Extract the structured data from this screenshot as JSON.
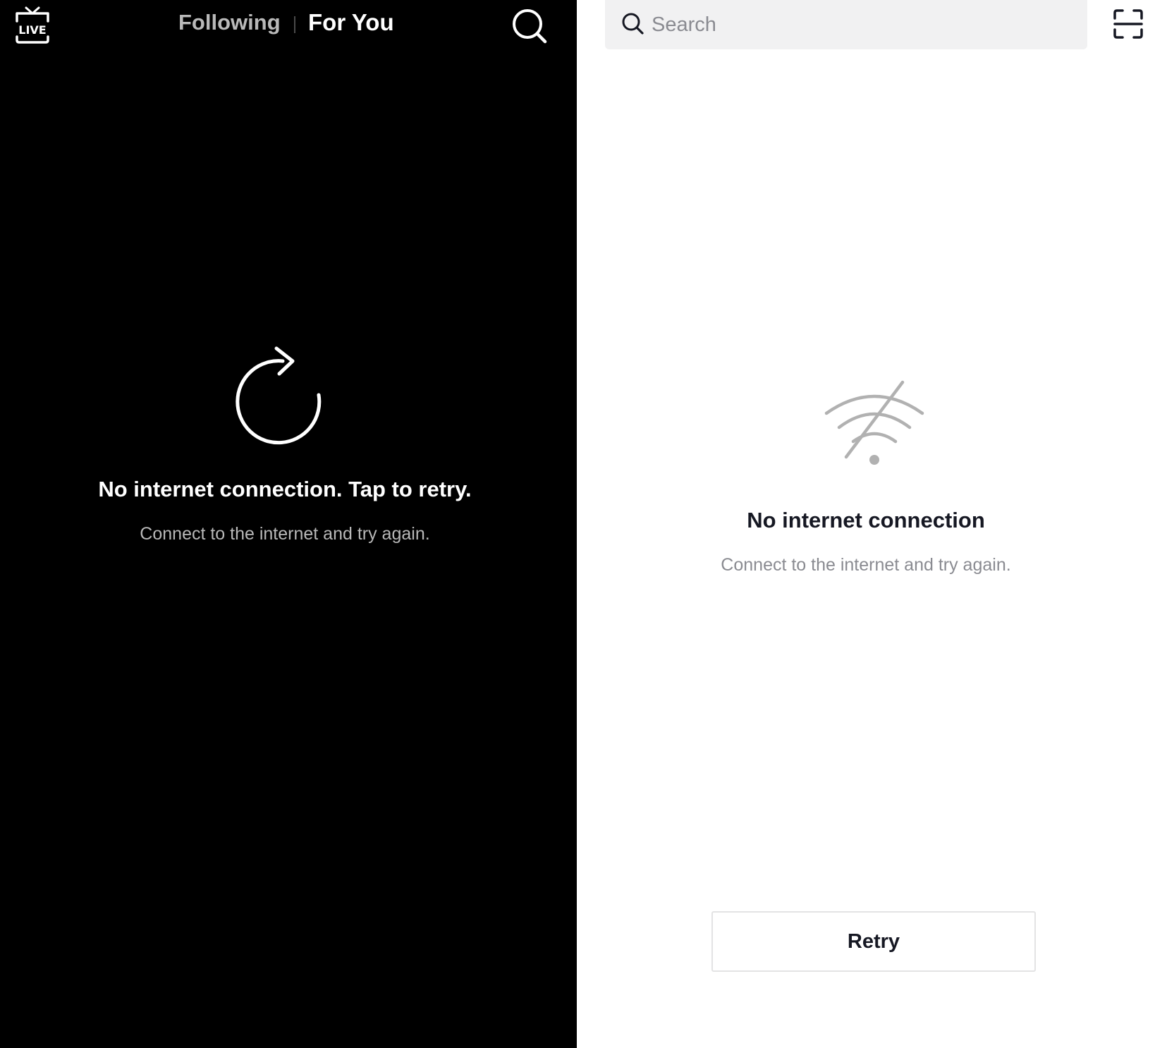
{
  "left_panel": {
    "live_icon": "live-tv-icon",
    "live_label": "LIVE",
    "tabs": [
      {
        "label": "Following",
        "active": false
      },
      {
        "label": "For You",
        "active": true
      }
    ],
    "search_icon": "search-icon",
    "retry_icon": "refresh-icon",
    "title": "No internet connection. Tap to retry.",
    "subtitle": "Connect to the internet and try again."
  },
  "right_panel": {
    "search": {
      "placeholder": "Search",
      "value": "",
      "icon": "search-icon"
    },
    "scan_icon": "scan-icon",
    "status_icon": "no-wifi-icon",
    "title": "No internet connection",
    "subtitle": "Connect to the internet and try again.",
    "retry_label": "Retry"
  },
  "colors": {
    "left_background": "#000000",
    "right_background": "#ffffff",
    "search_background": "#f1f1f2",
    "primary_text_dark": "#161823",
    "secondary_text": "#8a8b91",
    "inactive_tab": "#b9b9b9",
    "icon_gray": "#b1b1b1",
    "button_border": "#e3e3e4"
  }
}
